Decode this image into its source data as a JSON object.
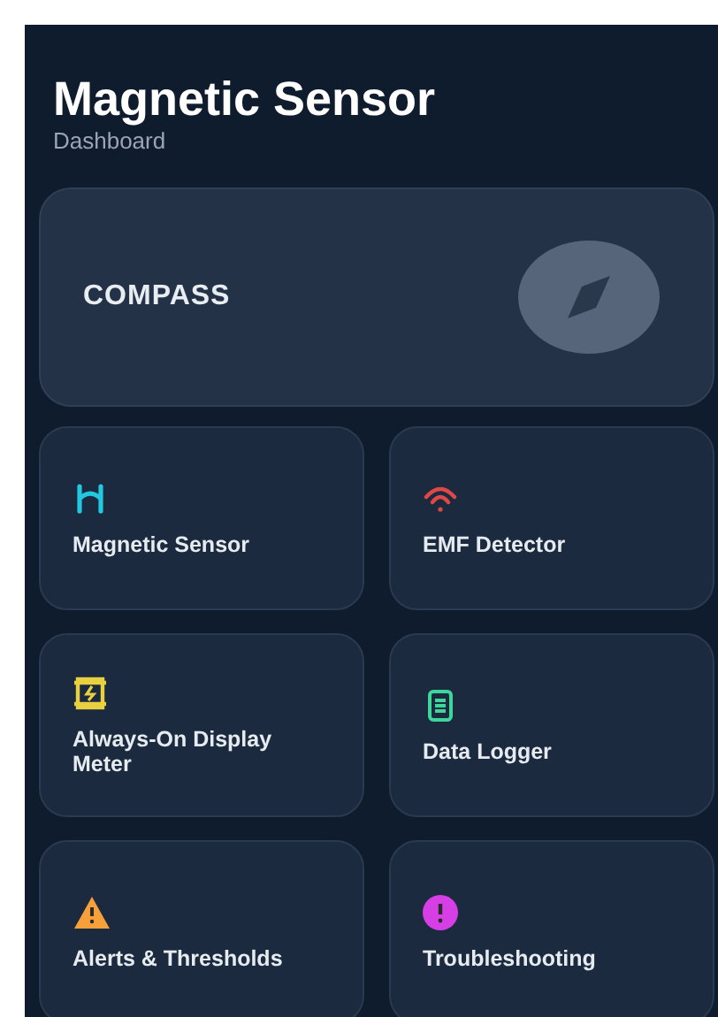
{
  "header": {
    "title": "Magnetic Sensor",
    "subtitle": "Dashboard"
  },
  "hero": {
    "label": "COMPASS",
    "kind": "compass"
  },
  "tiles": [
    {
      "label": "Magnetic Sensor",
      "kind": "magnet",
      "color": "#22c7e0"
    },
    {
      "label": "EMF Detector",
      "kind": "signal",
      "color": "#e04848"
    },
    {
      "label": "Always-On Display Meter",
      "kind": "display",
      "color": "#e8d040"
    },
    {
      "label": "Data Logger",
      "kind": "logger",
      "color": "#3ed69a"
    },
    {
      "label": "Alerts & Thresholds",
      "kind": "warning",
      "color": "#f5a03a"
    },
    {
      "label": "Troubleshooting",
      "kind": "alert",
      "color": "#d63ee6"
    }
  ]
}
